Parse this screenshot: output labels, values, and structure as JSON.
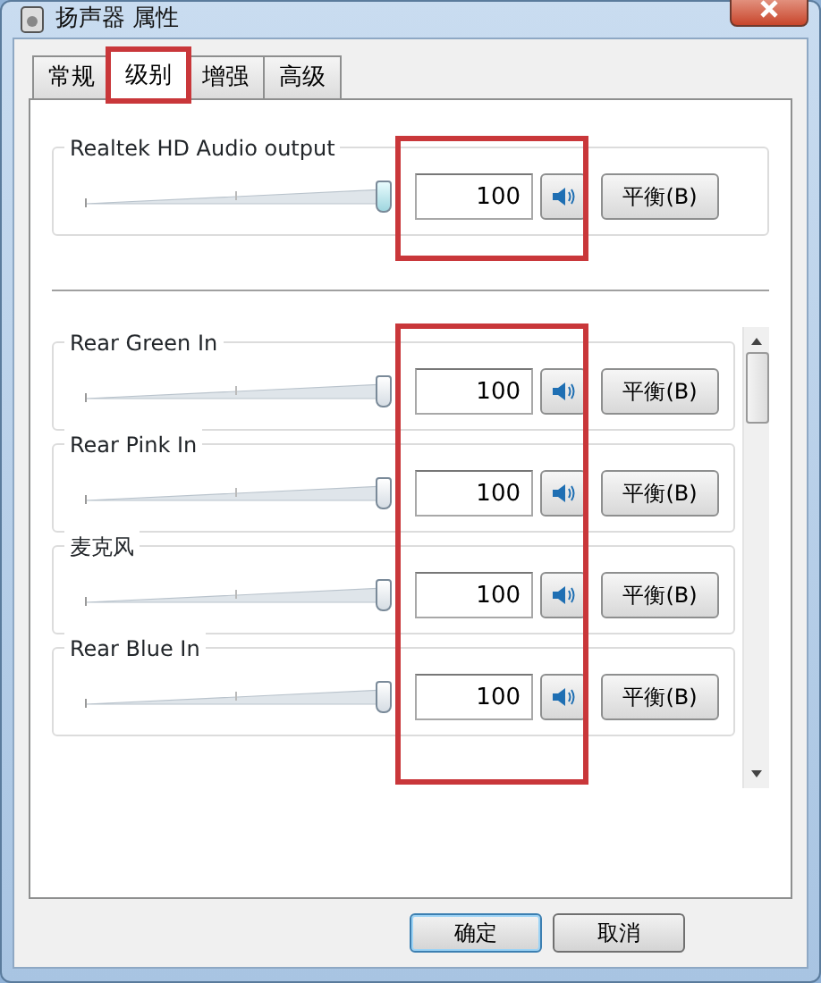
{
  "window": {
    "title": "扬声器 属性"
  },
  "tabs": [
    {
      "label": "常规",
      "selected": false,
      "highlighted": false
    },
    {
      "label": "级别",
      "selected": true,
      "highlighted": true
    },
    {
      "label": "增强",
      "selected": false,
      "highlighted": false
    },
    {
      "label": "高级",
      "selected": false,
      "highlighted": false
    }
  ],
  "master": {
    "name": "Realtek HD Audio output",
    "level": 1,
    "value": "100",
    "muted": false,
    "balance": "平衡(B)",
    "highlighted": true
  },
  "channels_highlighted": true,
  "channels": [
    {
      "name": "Rear Green In",
      "level": 1,
      "value": "100",
      "muted": false,
      "balance": "平衡(B)"
    },
    {
      "name": "Rear Pink In",
      "level": 1,
      "value": "100",
      "muted": false,
      "balance": "平衡(B)"
    },
    {
      "name": "麦克风",
      "level": 1,
      "value": "100",
      "muted": false,
      "balance": "平衡(B)"
    },
    {
      "name": "Rear Blue In",
      "level": 1,
      "value": "100",
      "muted": false,
      "balance": "平衡(B)"
    }
  ],
  "buttons": [
    "确定",
    "取消"
  ]
}
